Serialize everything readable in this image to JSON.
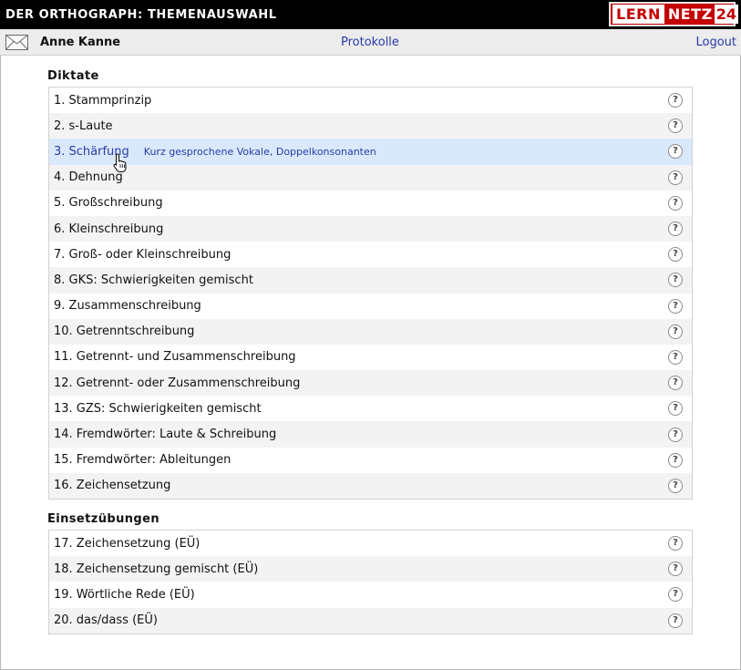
{
  "window": {
    "title": "DER ORTHOGRAPH: THEMENAUSWAHL"
  },
  "logo": {
    "part1": "LERN",
    "part2": "NETZ",
    "part3": "24"
  },
  "toolbar": {
    "mail_icon": "envelope-icon",
    "user_name": "Anne Kanne",
    "protocols_link": "Protokolle",
    "logout_link": "Logout"
  },
  "sections": [
    {
      "title": "Diktate",
      "items": [
        {
          "label": "1. Stammprinzip",
          "desc": ""
        },
        {
          "label": "2. s-Laute",
          "desc": ""
        },
        {
          "label": "3. Schärfung",
          "desc": "Kurz gesprochene Vokale, Doppelkonsonanten"
        },
        {
          "label": "4. Dehnung",
          "desc": ""
        },
        {
          "label": "5. Großschreibung",
          "desc": ""
        },
        {
          "label": "6. Kleinschreibung",
          "desc": ""
        },
        {
          "label": "7. Groß- oder Kleinschreibung",
          "desc": ""
        },
        {
          "label": "8. GKS: Schwierigkeiten gemischt",
          "desc": ""
        },
        {
          "label": "9. Zusammenschreibung",
          "desc": ""
        },
        {
          "label": "10. Getrenntschreibung",
          "desc": ""
        },
        {
          "label": "11. Getrennt- und Zusammenschreibung",
          "desc": ""
        },
        {
          "label": "12. Getrennt- oder Zusammenschreibung",
          "desc": ""
        },
        {
          "label": "13. GZS: Schwierigkeiten gemischt",
          "desc": ""
        },
        {
          "label": "14. Fremdwörter: Laute & Schreibung",
          "desc": ""
        },
        {
          "label": "15. Fremdwörter: Ableitungen",
          "desc": ""
        },
        {
          "label": "16. Zeichensetzung",
          "desc": ""
        }
      ]
    },
    {
      "title": "Einsetzübungen",
      "items": [
        {
          "label": "17. Zeichensetzung (EÜ)",
          "desc": ""
        },
        {
          "label": "18. Zeichensetzung gemischt (EÜ)",
          "desc": ""
        },
        {
          "label": "19. Wörtliche Rede (EÜ)",
          "desc": ""
        },
        {
          "label": "20. das/dass (EÜ)",
          "desc": ""
        }
      ]
    }
  ],
  "help_glyph": "?",
  "colors": {
    "link": "#2a3aa8",
    "highlight": "#d9e9fb",
    "logo_red": "#c40000"
  }
}
